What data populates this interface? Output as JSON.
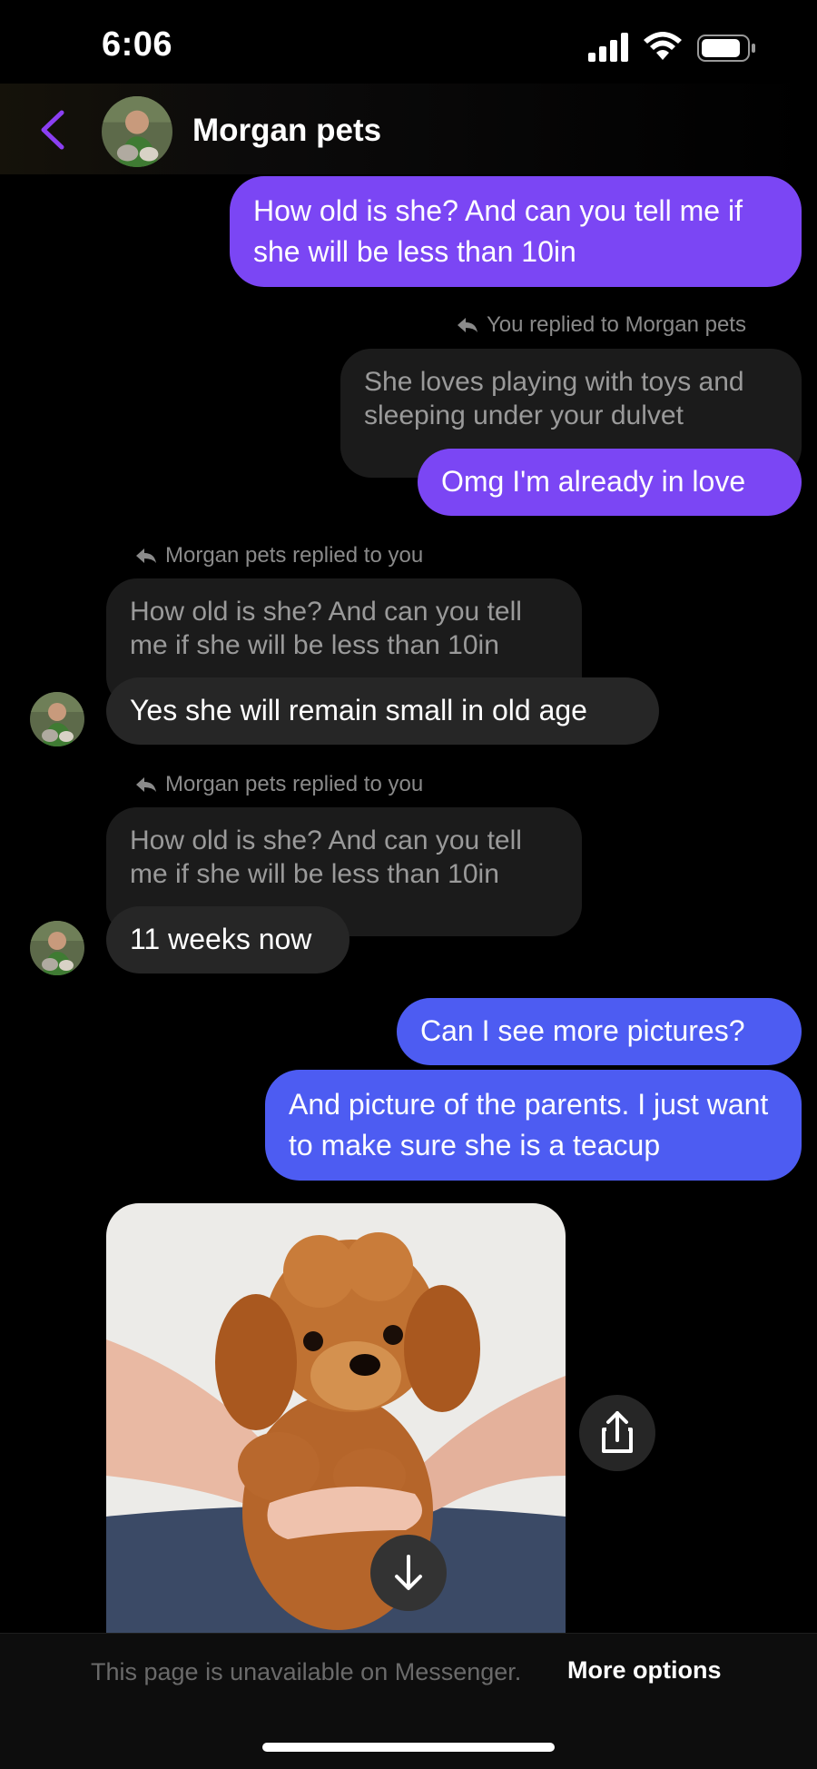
{
  "status_bar": {
    "time": "6:06"
  },
  "header": {
    "contact_name": "Morgan pets"
  },
  "messages": {
    "m1": {
      "text": "How old is she? And can you tell me if she will be less than 10in"
    },
    "reply1": {
      "label": "You replied to Morgan pets",
      "quoted": "She loves playing with toys and sleeping under your dulvet",
      "text": "Omg I'm already in love"
    },
    "reply2": {
      "label": "Morgan pets replied to you",
      "quoted": "How old is she? And can you tell me if she will be less than 10in",
      "text": "Yes she will remain small in old age"
    },
    "reply3": {
      "label": "Morgan pets replied to you",
      "quoted": "How old is she? And can you tell me if she will be less than 10in",
      "text": "11 weeks now"
    },
    "m5": {
      "text": "Can I see more pictures?"
    },
    "m6": {
      "text": "And picture of the parents. I just want to make sure she is a teacup"
    }
  },
  "footer": {
    "notice": "This page is unavailable on Messenger.",
    "more_options": "More options"
  },
  "icons": {
    "back": "chevron-left-icon",
    "reply": "reply-arrow-icon",
    "share": "share-icon",
    "scroll": "arrow-down-icon"
  },
  "colors": {
    "accent_purple": "#7b46f4",
    "accent_blue": "#4d5cf2",
    "incoming_bubble": "#262626",
    "background": "#000000"
  }
}
